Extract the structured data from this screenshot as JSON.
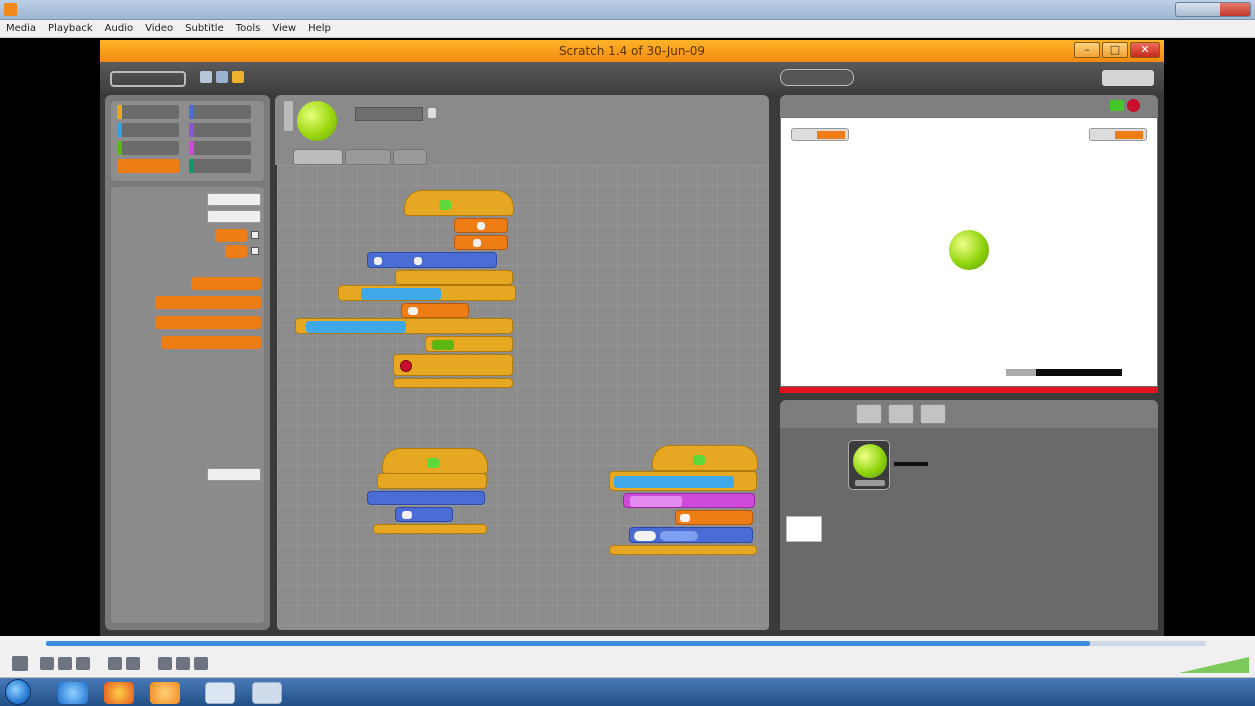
{
  "vlc": {
    "title": "",
    "menu": [
      "Media",
      "Playback",
      "Audio",
      "Video",
      "Subtitle",
      "Tools",
      "View",
      "Help"
    ],
    "time_elapsed": "",
    "time_total": "",
    "progress": 0.9,
    "volume_label": ""
  },
  "scratch": {
    "title": "Scratch 1.4 of 30-Jun-09",
    "file_menu": "",
    "sprites_label": "",
    "stage_monitors": [
      "",
      ""
    ]
  },
  "colors": {
    "scratch_title": "#f28a10",
    "control": "#e6a822",
    "motion": "#4a6cd4",
    "variables": "#ee7d16",
    "sensing": "#2ca5e2",
    "sound": "#cf4ad9",
    "pen": "#0e9a6c",
    "ground": "#e3131f",
    "ball": "#8fd40c",
    "vlc_progress": "#3e8ede",
    "taskbar": "#214f86"
  },
  "clock": {
    "time": "",
    "date": ""
  }
}
